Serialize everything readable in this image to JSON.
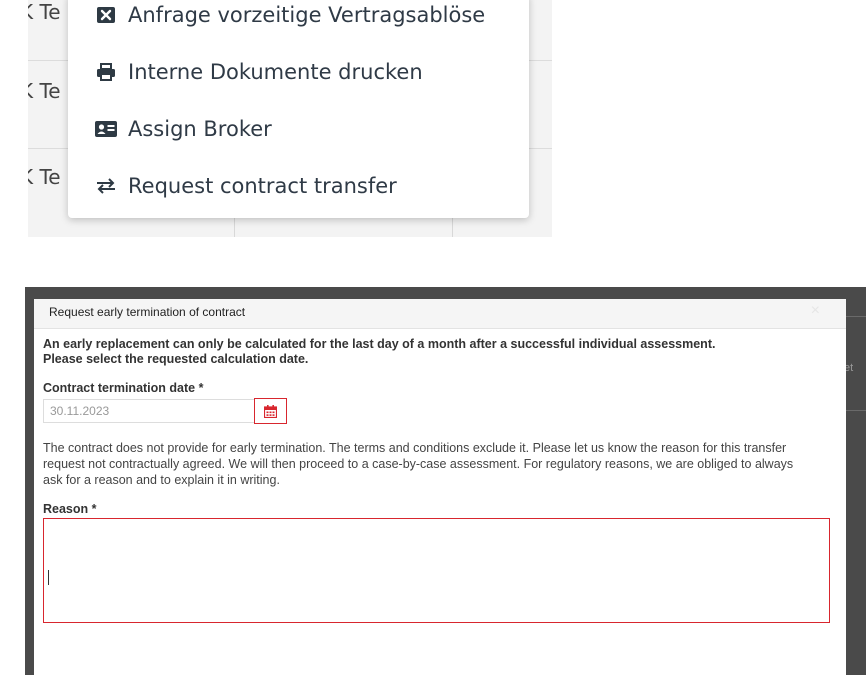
{
  "table_fragment": {
    "cell_text": [
      "K Te",
      "K Te",
      "K Te"
    ]
  },
  "context_menu": {
    "items": [
      {
        "label": "Anfrage vorzeitige Vertragsablöse",
        "icon": "close-square-icon"
      },
      {
        "label": "Interne Dokumente drucken",
        "icon": "printer-icon"
      },
      {
        "label": "Assign Broker",
        "icon": "id-card-icon"
      },
      {
        "label": "Request contract transfer",
        "icon": "exchange-icon"
      }
    ]
  },
  "modal": {
    "title": "Request early termination of contract",
    "close_label": "×",
    "intro_line1": "An early replacement can only be calculated for the last day of a month after a successful individual assessment.",
    "intro_line2": "Please select the requested calculation date.",
    "date_field": {
      "label": "Contract termination date *",
      "value": "30.11.2023",
      "button_icon": "calendar-icon"
    },
    "explanation": "The contract does not provide for early termination. The terms and conditions exclude it. Please let us know the reason for this transfer request not contractually agreed. We will then proceed to a case-by-case assessment. For regulatory reasons, we are obliged to always ask for a reason and to explain it in writing.",
    "reason_field": {
      "label": "Reason *",
      "value": ""
    }
  },
  "background_peek": {
    "text": "et"
  },
  "colors": {
    "error_border": "#d8262e",
    "modal_header_bg": "#f5f5f5",
    "backdrop": "#4a4a4a"
  }
}
